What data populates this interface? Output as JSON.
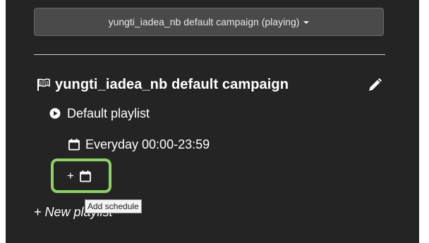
{
  "campaign_selector": {
    "label": "yungti_iadea_nb default campaign (playing)",
    "icon": "caret-down-icon"
  },
  "campaign": {
    "title": "yungti_iadea_nb default campaign",
    "icon": "flag-icon",
    "edit_icon": "pencil-icon"
  },
  "playlist": {
    "name": "Default playlist",
    "icon": "play-circle-icon",
    "schedule": {
      "label": "Everyday 00:00-23:59",
      "icon": "calendar-icon"
    },
    "add_schedule": {
      "prefix": "+",
      "icon": "calendar-icon",
      "tooltip": "Add schedule"
    }
  },
  "new_playlist": {
    "label": "+ New playlist"
  },
  "colors": {
    "panel_bg": "#242424",
    "highlight": "#8ecf68",
    "text": "#ffffff"
  }
}
